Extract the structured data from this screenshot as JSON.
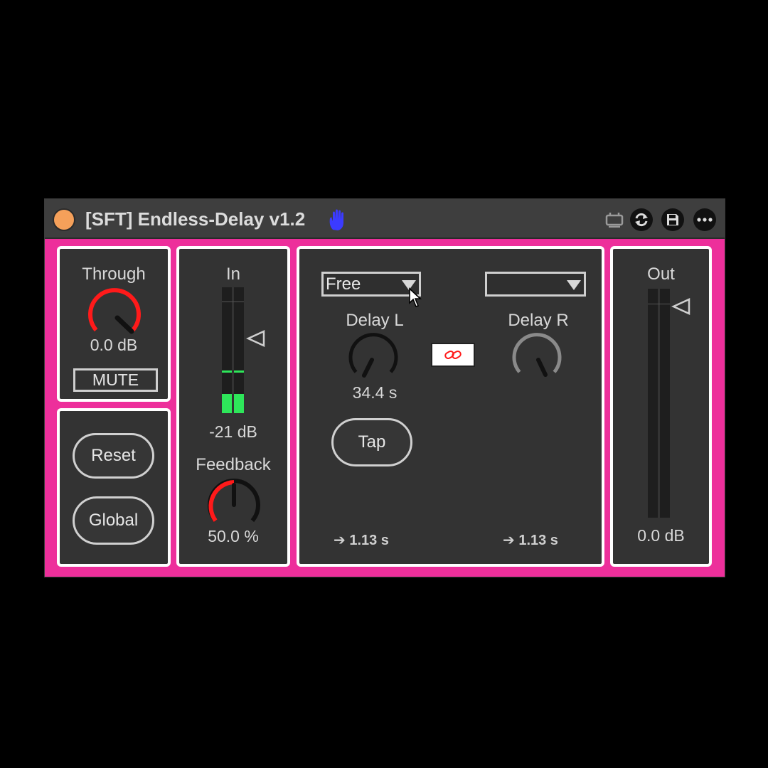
{
  "window": {
    "title": "[SFT] Endless-Delay v1.2",
    "icons": [
      "power-icon",
      "hand-icon",
      "mapping-icon",
      "refresh-icon",
      "save-icon",
      "more-icon"
    ]
  },
  "colors": {
    "accent": "#ed2f9b",
    "knob_red": "#ff1a1a",
    "meter_green": "#2ee65a",
    "panel": "#333333",
    "power": "#f5a05a",
    "hand": "#3b3bff"
  },
  "through": {
    "label": "Through",
    "value": "0.0 dB",
    "mute_label": "MUTE"
  },
  "buttons": {
    "reset": "Reset",
    "global": "Global"
  },
  "input": {
    "label": "In",
    "value": "-21 dB",
    "meter_level": 0.15,
    "peak_level": 0.33
  },
  "feedback": {
    "label": "Feedback",
    "value": "50.0 %",
    "amount": 0.5
  },
  "delay": {
    "mode_left": "Free",
    "mode_right": "",
    "left": {
      "label": "Delay L",
      "value": "34.4 s",
      "result": "➔ 1.13 s"
    },
    "right": {
      "label": "Delay R",
      "result": "➔ 1.13 s"
    },
    "tap_label": "Tap",
    "link_icon": "link-icon"
  },
  "output": {
    "label": "Out",
    "value": "0.0 dB"
  }
}
